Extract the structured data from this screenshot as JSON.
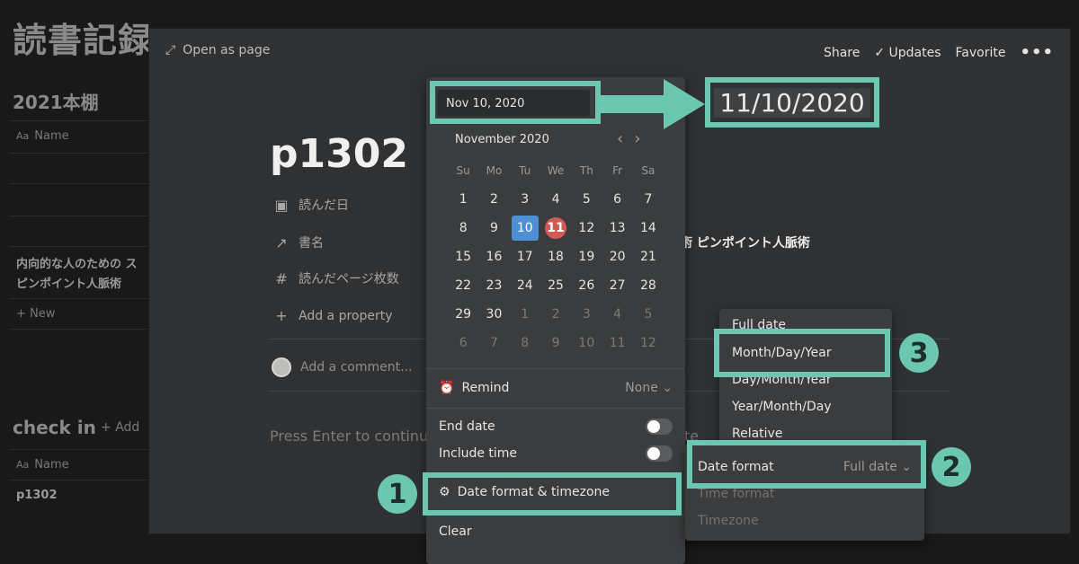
{
  "background": {
    "title": "読書記録",
    "section1": "2021本棚",
    "col_name_1": "Name",
    "row_text": "内向的な人のための ス\nピンポイント人脈術",
    "new_label": "New",
    "section2": "check in",
    "add_label": "Add",
    "col_name_2": "Name",
    "row2_text": "p1302"
  },
  "modal": {
    "open_as_page": "Open as page",
    "share": "Share",
    "updates": "Updates",
    "favorite": "Favorite",
    "more": "•••",
    "page_title": "p1302",
    "props": [
      {
        "icon": "calendar-icon",
        "label": "読んだ日"
      },
      {
        "icon": "arrow-up-right-icon",
        "label": "書名"
      },
      {
        "icon": "hash-icon",
        "label": "読んだページ枚数"
      }
    ],
    "prop_value": "術 ピンポイント人脈術",
    "add_property": "Add a property",
    "add_comment": "Add a comment...",
    "press_enter": "Press Enter to continue",
    "press_enter_tail": "te"
  },
  "datepicker": {
    "input_value": "Nov 10, 2020",
    "month_label": "November 2020",
    "weekdays": [
      "Su",
      "Mo",
      "Tu",
      "We",
      "Th",
      "Fr",
      "Sa"
    ],
    "days": [
      "1",
      "2",
      "3",
      "4",
      "5",
      "6",
      "7",
      "8",
      "9",
      "10",
      "11",
      "12",
      "13",
      "14",
      "15",
      "16",
      "17",
      "18",
      "19",
      "20",
      "21",
      "22",
      "23",
      "24",
      "25",
      "26",
      "27",
      "28",
      "29",
      "30",
      "1",
      "2",
      "3",
      "4",
      "5",
      "6",
      "7",
      "8",
      "9",
      "10",
      "11",
      "12"
    ],
    "selected_day": "10",
    "today_day": "11",
    "remind_label": "Remind",
    "remind_value": "None",
    "end_date": "End date",
    "include_time": "Include time",
    "date_format_tz": "Date format & timezone",
    "clear": "Clear"
  },
  "format_menu": {
    "items": [
      "Full date",
      "Month/Day/Year",
      "Day/Month/Year",
      "Year/Month/Day",
      "Relative"
    ]
  },
  "settings_menu": {
    "date_format": "Date format",
    "date_format_value": "Full date",
    "time_format": "Time format",
    "timezone": "Timezone"
  },
  "annotation": {
    "result_date": "11/10/2020",
    "n1": "1",
    "n2": "2",
    "n3": "3",
    "accent": "#6bc7b0"
  }
}
